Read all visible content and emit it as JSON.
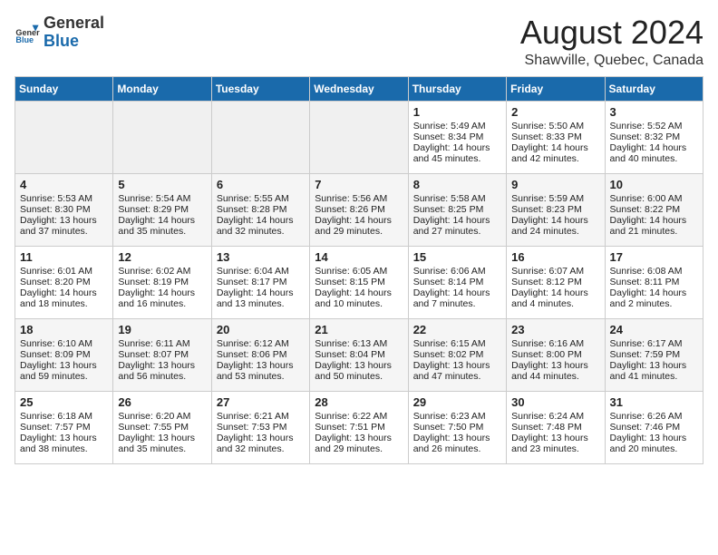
{
  "header": {
    "logo_general": "General",
    "logo_blue": "Blue",
    "month_title": "August 2024",
    "subtitle": "Shawville, Quebec, Canada"
  },
  "days_of_week": [
    "Sunday",
    "Monday",
    "Tuesday",
    "Wednesday",
    "Thursday",
    "Friday",
    "Saturday"
  ],
  "weeks": [
    [
      {
        "day": "",
        "empty": true
      },
      {
        "day": "",
        "empty": true
      },
      {
        "day": "",
        "empty": true
      },
      {
        "day": "",
        "empty": true
      },
      {
        "day": "1",
        "sunrise": "5:49 AM",
        "sunset": "8:34 PM",
        "daylight": "14 hours and 45 minutes."
      },
      {
        "day": "2",
        "sunrise": "5:50 AM",
        "sunset": "8:33 PM",
        "daylight": "14 hours and 42 minutes."
      },
      {
        "day": "3",
        "sunrise": "5:52 AM",
        "sunset": "8:32 PM",
        "daylight": "14 hours and 40 minutes."
      }
    ],
    [
      {
        "day": "4",
        "sunrise": "5:53 AM",
        "sunset": "8:30 PM",
        "daylight": "13 hours and 37 minutes."
      },
      {
        "day": "5",
        "sunrise": "5:54 AM",
        "sunset": "8:29 PM",
        "daylight": "14 hours and 35 minutes."
      },
      {
        "day": "6",
        "sunrise": "5:55 AM",
        "sunset": "8:28 PM",
        "daylight": "14 hours and 32 minutes."
      },
      {
        "day": "7",
        "sunrise": "5:56 AM",
        "sunset": "8:26 PM",
        "daylight": "14 hours and 29 minutes."
      },
      {
        "day": "8",
        "sunrise": "5:58 AM",
        "sunset": "8:25 PM",
        "daylight": "14 hours and 27 minutes."
      },
      {
        "day": "9",
        "sunrise": "5:59 AM",
        "sunset": "8:23 PM",
        "daylight": "14 hours and 24 minutes."
      },
      {
        "day": "10",
        "sunrise": "6:00 AM",
        "sunset": "8:22 PM",
        "daylight": "14 hours and 21 minutes."
      }
    ],
    [
      {
        "day": "11",
        "sunrise": "6:01 AM",
        "sunset": "8:20 PM",
        "daylight": "14 hours and 18 minutes."
      },
      {
        "day": "12",
        "sunrise": "6:02 AM",
        "sunset": "8:19 PM",
        "daylight": "14 hours and 16 minutes."
      },
      {
        "day": "13",
        "sunrise": "6:04 AM",
        "sunset": "8:17 PM",
        "daylight": "14 hours and 13 minutes."
      },
      {
        "day": "14",
        "sunrise": "6:05 AM",
        "sunset": "8:15 PM",
        "daylight": "14 hours and 10 minutes."
      },
      {
        "day": "15",
        "sunrise": "6:06 AM",
        "sunset": "8:14 PM",
        "daylight": "14 hours and 7 minutes."
      },
      {
        "day": "16",
        "sunrise": "6:07 AM",
        "sunset": "8:12 PM",
        "daylight": "14 hours and 4 minutes."
      },
      {
        "day": "17",
        "sunrise": "6:08 AM",
        "sunset": "8:11 PM",
        "daylight": "14 hours and 2 minutes."
      }
    ],
    [
      {
        "day": "18",
        "sunrise": "6:10 AM",
        "sunset": "8:09 PM",
        "daylight": "13 hours and 59 minutes."
      },
      {
        "day": "19",
        "sunrise": "6:11 AM",
        "sunset": "8:07 PM",
        "daylight": "13 hours and 56 minutes."
      },
      {
        "day": "20",
        "sunrise": "6:12 AM",
        "sunset": "8:06 PM",
        "daylight": "13 hours and 53 minutes."
      },
      {
        "day": "21",
        "sunrise": "6:13 AM",
        "sunset": "8:04 PM",
        "daylight": "13 hours and 50 minutes."
      },
      {
        "day": "22",
        "sunrise": "6:15 AM",
        "sunset": "8:02 PM",
        "daylight": "13 hours and 47 minutes."
      },
      {
        "day": "23",
        "sunrise": "6:16 AM",
        "sunset": "8:00 PM",
        "daylight": "13 hours and 44 minutes."
      },
      {
        "day": "24",
        "sunrise": "6:17 AM",
        "sunset": "7:59 PM",
        "daylight": "13 hours and 41 minutes."
      }
    ],
    [
      {
        "day": "25",
        "sunrise": "6:18 AM",
        "sunset": "7:57 PM",
        "daylight": "13 hours and 38 minutes."
      },
      {
        "day": "26",
        "sunrise": "6:20 AM",
        "sunset": "7:55 PM",
        "daylight": "13 hours and 35 minutes."
      },
      {
        "day": "27",
        "sunrise": "6:21 AM",
        "sunset": "7:53 PM",
        "daylight": "13 hours and 32 minutes."
      },
      {
        "day": "28",
        "sunrise": "6:22 AM",
        "sunset": "7:51 PM",
        "daylight": "13 hours and 29 minutes."
      },
      {
        "day": "29",
        "sunrise": "6:23 AM",
        "sunset": "7:50 PM",
        "daylight": "13 hours and 26 minutes."
      },
      {
        "day": "30",
        "sunrise": "6:24 AM",
        "sunset": "7:48 PM",
        "daylight": "13 hours and 23 minutes."
      },
      {
        "day": "31",
        "sunrise": "6:26 AM",
        "sunset": "7:46 PM",
        "daylight": "13 hours and 20 minutes."
      }
    ]
  ]
}
